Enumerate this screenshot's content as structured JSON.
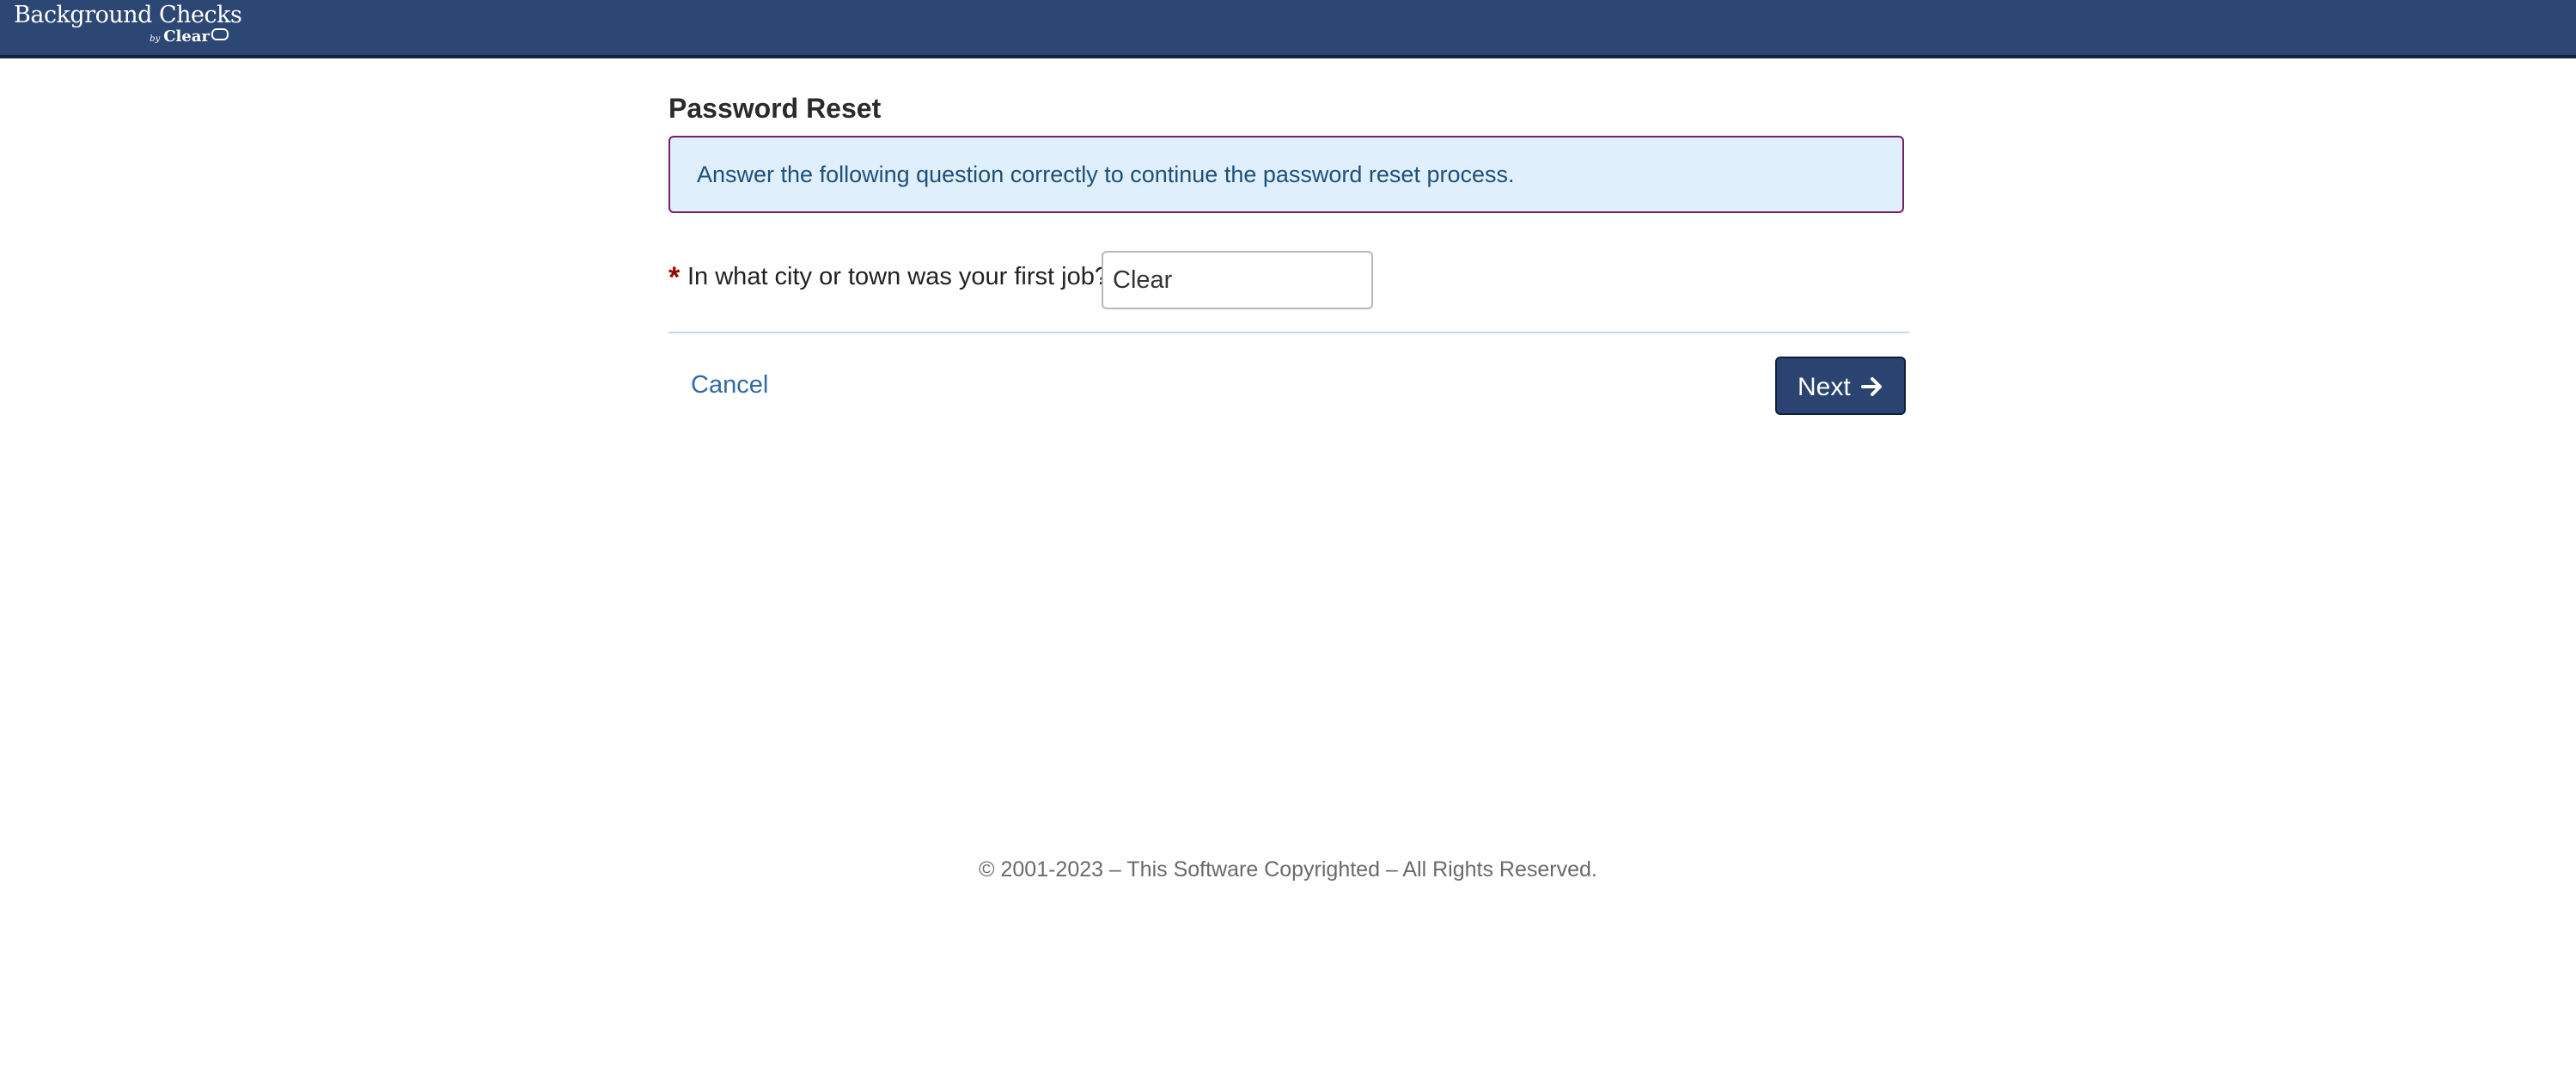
{
  "header": {
    "logo_title": "Background Checks",
    "logo_by": "by",
    "logo_brand": "Clear",
    "logo_icon": "clearstar-mark-icon",
    "bar_color": "#2d4775"
  },
  "page": {
    "title": "Password Reset",
    "info_message": "Answer the following question correctly to continue the password reset process."
  },
  "form": {
    "required_marker": "*",
    "question_label": "In what city or town was your first job?",
    "answer_value": "Clear"
  },
  "actions": {
    "cancel_label": "Cancel",
    "next_label": "Next",
    "next_icon": "arrow-right-icon",
    "next_color": "#2a4370"
  },
  "footer": {
    "copyright": "© 2001-2023 – This Software Copyrighted – All Rights Reserved."
  }
}
